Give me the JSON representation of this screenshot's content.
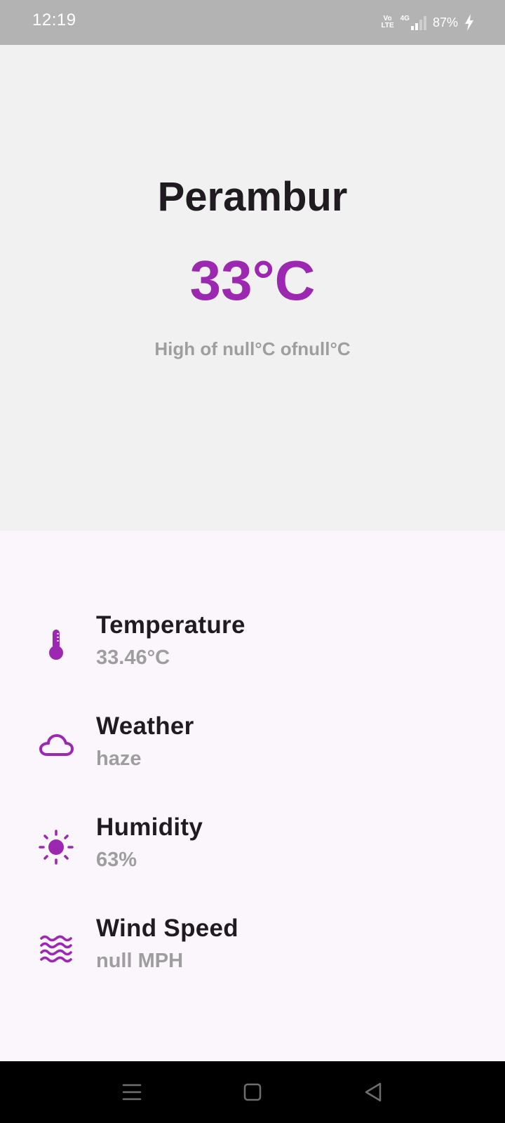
{
  "status_bar": {
    "time": "12:19",
    "volte_top": "Vo",
    "volte_bottom": "LTE",
    "network": "4G",
    "battery": "87%"
  },
  "header": {
    "city": "Perambur",
    "temperature": "33°C",
    "range_text": "High of null°C ofnull°C"
  },
  "details": [
    {
      "label": "Temperature",
      "value": "33.46°C",
      "icon": "thermometer-icon"
    },
    {
      "label": "Weather",
      "value": "haze",
      "icon": "cloud-icon"
    },
    {
      "label": "Humidity",
      "value": "63%",
      "icon": "sun-icon"
    },
    {
      "label": "Wind Speed",
      "value": "null MPH",
      "icon": "waves-icon"
    }
  ],
  "colors": {
    "accent": "#9c27b0",
    "title": "#1f1b20",
    "secondary": "#9e9e9e",
    "top_panel_bg": "#f1f1f1",
    "details_bg": "#fbf5fc"
  },
  "nav": {
    "recents_icon": "menu-icon",
    "home_icon": "square-icon",
    "back_icon": "triangle-back-icon"
  }
}
